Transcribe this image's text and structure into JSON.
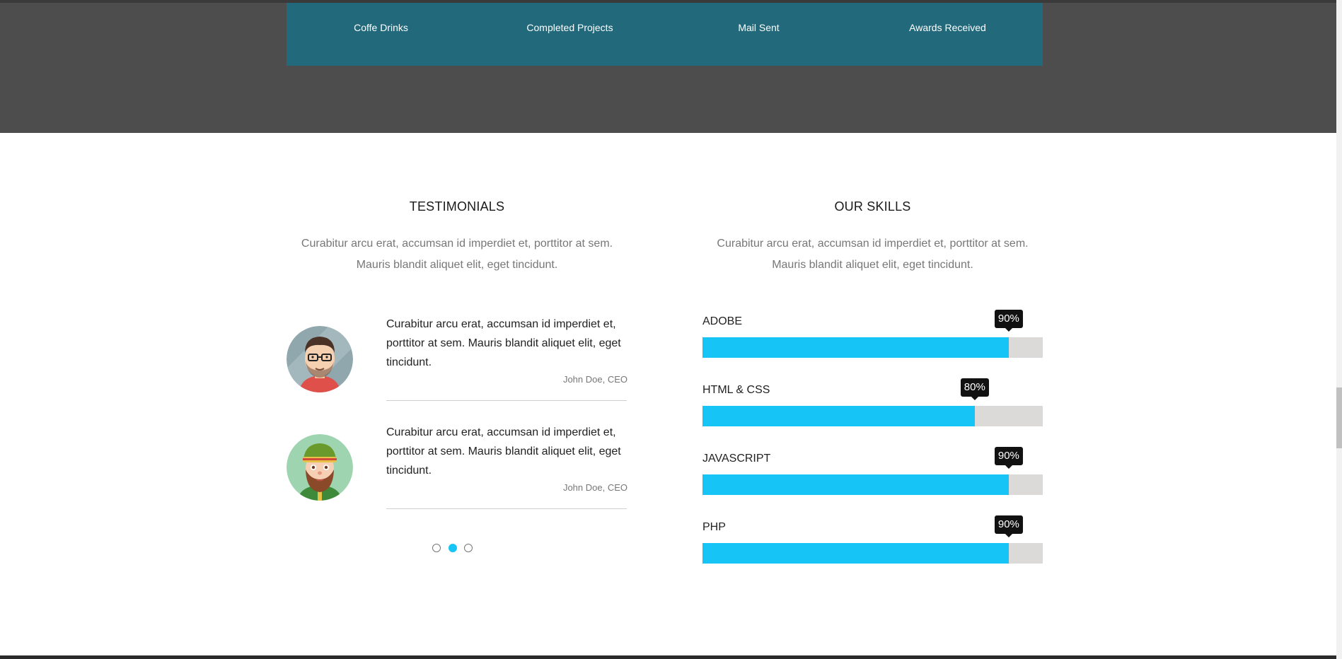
{
  "stats": [
    {
      "label": "Coffe Drinks"
    },
    {
      "label": "Completed Projects"
    },
    {
      "label": "Mail Sent"
    },
    {
      "label": "Awards Received"
    }
  ],
  "testimonials": {
    "title": "TESTIMONIALS",
    "desc_line1": "Curabitur arcu erat, accumsan id imperdiet et, porttitor at sem.",
    "desc_line2": "Mauris blandit aliquet elit, eget tincidunt.",
    "items": [
      {
        "text": "Curabitur arcu erat, accumsan id imperdiet et, porttitor at sem. Mauris blandit aliquet elit, eget tincidunt.",
        "author": "John Doe, CEO",
        "avatar_icon": "man-with-glasses-avatar"
      },
      {
        "text": "Curabitur arcu erat, accumsan id imperdiet et, porttitor at sem. Mauris blandit aliquet elit, eget tincidunt.",
        "author": "John Doe, CEO",
        "avatar_icon": "bearded-man-hat-avatar"
      }
    ],
    "pagination": {
      "count": 3,
      "active_index": 1
    }
  },
  "skills": {
    "title": "OUR SKILLS",
    "desc_line1": "Curabitur arcu erat, accumsan id imperdiet et, porttitor at sem.",
    "desc_line2": "Mauris blandit aliquet elit, eget tincidunt.",
    "items": [
      {
        "name": "ADOBE",
        "percent": 90,
        "label": "90%"
      },
      {
        "name": "HTML & CSS",
        "percent": 80,
        "label": "80%"
      },
      {
        "name": "JAVASCRIPT",
        "percent": 90,
        "label": "90%"
      },
      {
        "name": "PHP",
        "percent": 90,
        "label": "90%"
      }
    ]
  },
  "colors": {
    "accent": "#17c4f6",
    "stats_bg": "#22697b",
    "dark_band": "#4d4d4d",
    "track": "#dcd9d9"
  }
}
